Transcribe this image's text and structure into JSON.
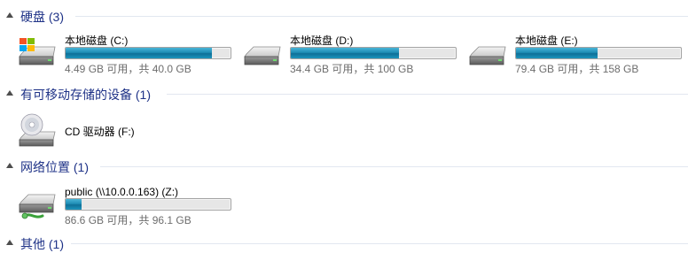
{
  "groups": [
    {
      "title": "硬盘 (3)",
      "items": [
        {
          "name": "本地磁盘 (C:)",
          "free_text": "4.49 GB 可用，共 40.0 GB",
          "used_fraction": 0.888,
          "icon": "windows-drive-icon"
        },
        {
          "name": "本地磁盘 (D:)",
          "free_text": "34.4 GB 可用，共 100 GB",
          "used_fraction": 0.656,
          "icon": "hard-drive-icon"
        },
        {
          "name": "本地磁盘 (E:)",
          "free_text": "79.4 GB 可用，共 158 GB",
          "used_fraction": 0.497,
          "icon": "hard-drive-icon"
        }
      ]
    },
    {
      "title": "有可移动存储的设备 (1)",
      "items": [
        {
          "name": "CD 驱动器 (F:)",
          "icon": "cd-drive-icon"
        }
      ]
    },
    {
      "title": "网络位置 (1)",
      "items": [
        {
          "name": "public (\\\\10.0.0.163) (Z:)",
          "free_text": "86.6 GB 可用，共 96.1 GB",
          "used_fraction": 0.099,
          "icon": "network-drive-icon"
        }
      ]
    },
    {
      "title": "其他 (1)"
    }
  ],
  "colors": {
    "group_title": "#1e3287",
    "bar_fill": "#1f8db5",
    "free_text": "#6d6d6d"
  }
}
